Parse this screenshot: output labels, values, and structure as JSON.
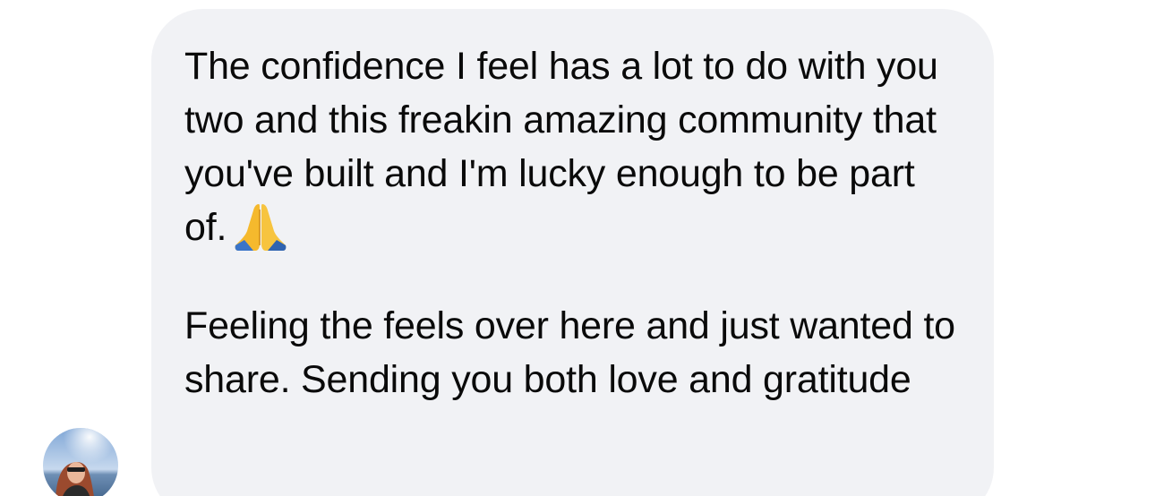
{
  "thread": {
    "message": {
      "paragraph_1": "The confidence I feel has a lot to do with you two and this freakin amazing community that you've built and I'm lucky enough to be part of.",
      "emoji": "folded-hands-icon",
      "paragraph_2": "Feeling the feels over here and just wanted to share. Sending you both love and gratitude"
    },
    "sender": {
      "avatar": "profile-photo"
    }
  },
  "colors": {
    "bubble": "#f1f2f5",
    "text": "#0a0a0a",
    "background": "#ffffff"
  }
}
